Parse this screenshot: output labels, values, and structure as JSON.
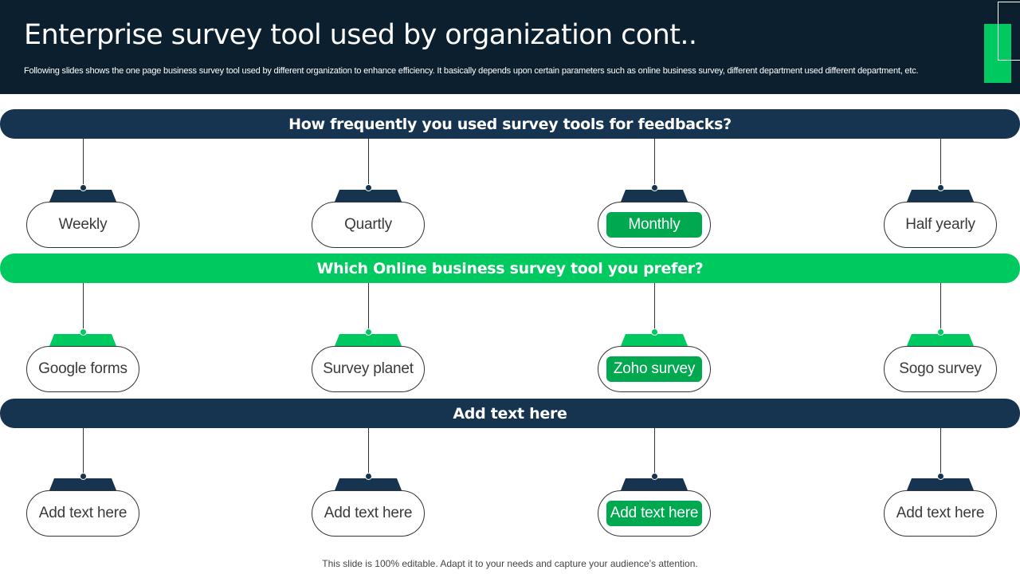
{
  "header": {
    "title": "Enterprise survey tool used by organization cont..",
    "subtitle": "Following slides shows the one page business survey tool used by different organization to enhance efficiency. It basically depends upon certain parameters such as online business survey, different department used different department, etc."
  },
  "colors": {
    "navy": "#16344f",
    "green": "#00c95f",
    "highlight": "#00a84f",
    "header_bg": "#0c1f2f"
  },
  "rows": [
    {
      "question": "How frequently you used survey tools for feedbacks?",
      "color": "navy",
      "options": [
        "Weekly",
        "Quartly",
        "Monthly",
        "Half yearly"
      ],
      "highlighted": "Monthly"
    },
    {
      "question": "Which Online business survey tool you prefer?",
      "color": "green",
      "options": [
        "Google forms",
        "Survey planet",
        "Zoho survey",
        "Sogo survey"
      ],
      "highlighted": "Zoho survey"
    },
    {
      "question": "Add text here",
      "color": "navy",
      "options": [
        "Add text here",
        "Add text here",
        "Add text here",
        "Add text here"
      ],
      "highlighted": "Add text here"
    }
  ],
  "footer": "This slide is 100% editable. Adapt it to your needs and capture your audience’s attention."
}
